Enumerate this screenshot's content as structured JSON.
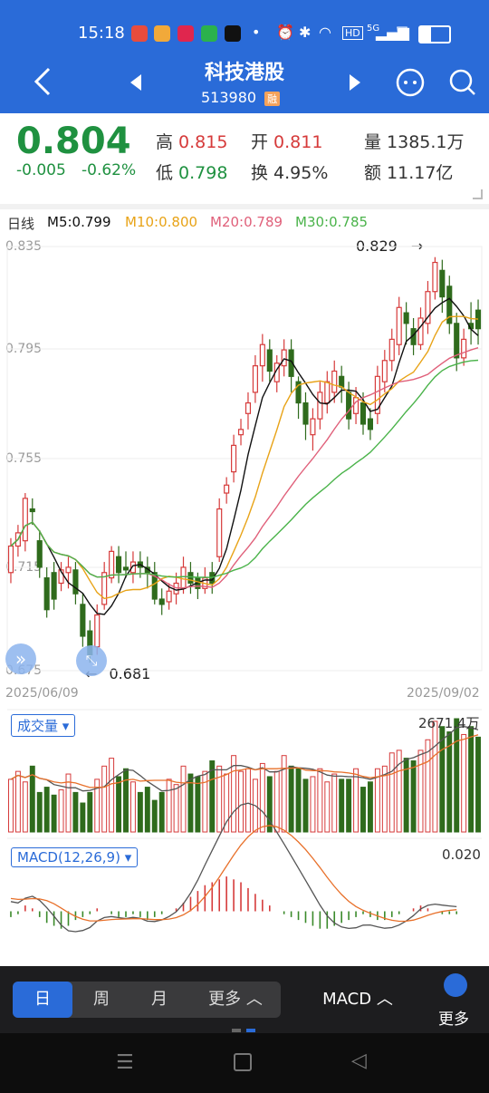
{
  "status": {
    "time": "15:18",
    "right_badges": [
      "HD",
      "5G"
    ]
  },
  "header": {
    "title": "科技港股",
    "code": "513980",
    "badge": "融"
  },
  "quote": {
    "price": "0.804",
    "change": "-0.005",
    "change_pct": "-0.62%",
    "high_label": "高",
    "high": "0.815",
    "open_label": "开",
    "open": "0.811",
    "volume_label": "量",
    "volume": "1385.1万",
    "low_label": "低",
    "low": "0.798",
    "turnover_label": "换",
    "turnover": "4.95%",
    "amount_label": "额",
    "amount": "11.17亿"
  },
  "ma_legend": {
    "period": "日线",
    "m5": "M5:0.799",
    "m10": "M10:0.800",
    "m20": "M20:0.789",
    "m30": "M30:0.785"
  },
  "chart_data": [
    {
      "type": "candlestick",
      "y_ticks": [
        "0.835",
        "0.795",
        "0.755",
        "0.715",
        "0.675"
      ],
      "ylim": [
        0.675,
        0.835
      ],
      "x_start": "2025/06/09",
      "x_end": "2025/09/02",
      "annotations": [
        {
          "text": "0.829",
          "arrow": "→"
        },
        {
          "text": "0.681",
          "arrow": "←"
        }
      ],
      "candles": [
        [
          0.712,
          0.722,
          0.708,
          0.725
        ],
        [
          0.722,
          0.727,
          0.718,
          0.73
        ],
        [
          0.724,
          0.74,
          0.72,
          0.742
        ],
        [
          0.736,
          0.735,
          0.73,
          0.74
        ],
        [
          0.724,
          0.714,
          0.71,
          0.728
        ],
        [
          0.71,
          0.698,
          0.695,
          0.714
        ],
        [
          0.712,
          0.702,
          0.698,
          0.716
        ],
        [
          0.708,
          0.713,
          0.705,
          0.716
        ],
        [
          0.712,
          0.714,
          0.706,
          0.718
        ],
        [
          0.713,
          0.704,
          0.7,
          0.716
        ],
        [
          0.7,
          0.688,
          0.684,
          0.704
        ],
        [
          0.69,
          0.681,
          0.678,
          0.694
        ],
        [
          0.684,
          0.696,
          0.681,
          0.7
        ],
        [
          0.7,
          0.712,
          0.698,
          0.716
        ],
        [
          0.71,
          0.72,
          0.708,
          0.722
        ],
        [
          0.718,
          0.712,
          0.708,
          0.722
        ],
        [
          0.714,
          0.713,
          0.71,
          0.72
        ],
        [
          0.712,
          0.716,
          0.708,
          0.72
        ],
        [
          0.716,
          0.714,
          0.71,
          0.72
        ],
        [
          0.714,
          0.712,
          0.706,
          0.718
        ],
        [
          0.712,
          0.702,
          0.7,
          0.716
        ],
        [
          0.702,
          0.7,
          0.696,
          0.706
        ],
        [
          0.701,
          0.705,
          0.698,
          0.708
        ],
        [
          0.704,
          0.708,
          0.7,
          0.712
        ],
        [
          0.706,
          0.714,
          0.704,
          0.718
        ],
        [
          0.712,
          0.708,
          0.704,
          0.716
        ],
        [
          0.71,
          0.706,
          0.702,
          0.712
        ],
        [
          0.706,
          0.71,
          0.704,
          0.714
        ],
        [
          0.712,
          0.708,
          0.704,
          0.716
        ],
        [
          0.718,
          0.736,
          0.716,
          0.74
        ],
        [
          0.742,
          0.745,
          0.738,
          0.748
        ],
        [
          0.75,
          0.76,
          0.746,
          0.764
        ],
        [
          0.764,
          0.766,
          0.76,
          0.77
        ],
        [
          0.772,
          0.776,
          0.766,
          0.78
        ],
        [
          0.78,
          0.79,
          0.776,
          0.794
        ],
        [
          0.79,
          0.798,
          0.784,
          0.802
        ],
        [
          0.796,
          0.788,
          0.784,
          0.8
        ],
        [
          0.784,
          0.791,
          0.78,
          0.794
        ],
        [
          0.79,
          0.796,
          0.786,
          0.8
        ],
        [
          0.796,
          0.786,
          0.78,
          0.8
        ],
        [
          0.784,
          0.776,
          0.77,
          0.786
        ],
        [
          0.776,
          0.768,
          0.762,
          0.78
        ],
        [
          0.764,
          0.77,
          0.758,
          0.774
        ],
        [
          0.77,
          0.78,
          0.766,
          0.784
        ],
        [
          0.776,
          0.784,
          0.772,
          0.788
        ],
        [
          0.78,
          0.788,
          0.776,
          0.792
        ],
        [
          0.786,
          0.782,
          0.776,
          0.79
        ],
        [
          0.78,
          0.77,
          0.766,
          0.784
        ],
        [
          0.772,
          0.778,
          0.768,
          0.782
        ],
        [
          0.776,
          0.768,
          0.764,
          0.78
        ],
        [
          0.77,
          0.766,
          0.762,
          0.774
        ],
        [
          0.772,
          0.786,
          0.768,
          0.79
        ],
        [
          0.784,
          0.792,
          0.78,
          0.796
        ],
        [
          0.792,
          0.8,
          0.788,
          0.804
        ],
        [
          0.798,
          0.812,
          0.794,
          0.816
        ],
        [
          0.81,
          0.806,
          0.798,
          0.814
        ],
        [
          0.804,
          0.798,
          0.794,
          0.808
        ],
        [
          0.798,
          0.808,
          0.796,
          0.812
        ],
        [
          0.806,
          0.818,
          0.802,
          0.822
        ],
        [
          0.818,
          0.829,
          0.815,
          0.831
        ],
        [
          0.826,
          0.816,
          0.81,
          0.83
        ],
        [
          0.82,
          0.806,
          0.802,
          0.824
        ],
        [
          0.806,
          0.793,
          0.788,
          0.81
        ],
        [
          0.793,
          0.8,
          0.79,
          0.804
        ],
        [
          0.806,
          0.804,
          0.798,
          0.814
        ],
        [
          0.811,
          0.804,
          0.798,
          0.815
        ]
      ]
    },
    {
      "type": "bar",
      "label": "成交量",
      "max_label": "2671.4万",
      "values": [
        40,
        46,
        38,
        50,
        30,
        34,
        28,
        32,
        44,
        30,
        22,
        30,
        40,
        50,
        56,
        42,
        48,
        38,
        30,
        34,
        24,
        30,
        40,
        36,
        50,
        44,
        42,
        46,
        54,
        50,
        44,
        58,
        46,
        48,
        40,
        52,
        42,
        46,
        58,
        50,
        48,
        40,
        42,
        48,
        38,
        44,
        40,
        40,
        48,
        34,
        38,
        48,
        50,
        60,
        62,
        56,
        54,
        62,
        70,
        84,
        80,
        76,
        86,
        74,
        80,
        72
      ]
    },
    {
      "type": "bar",
      "label": "MACD(12,26,9)",
      "max_label": "0.020",
      "values": [
        -2,
        -1,
        2,
        1,
        -2,
        -4,
        -5,
        -6,
        -5,
        -3,
        -2,
        -1,
        1,
        0,
        -1,
        -2,
        -2,
        -1,
        -2,
        -3,
        -2,
        -1,
        0,
        1,
        3,
        5,
        7,
        9,
        10,
        11,
        12,
        11,
        10,
        8,
        6,
        4,
        2,
        0,
        -1,
        -2,
        -3,
        -4,
        -5,
        -6,
        -6,
        -5,
        -4,
        -3,
        -2,
        -1,
        -2,
        -3,
        -3,
        -2,
        -1,
        0,
        1,
        2,
        1,
        0,
        -1,
        -1,
        -1
      ]
    }
  ],
  "volume_legend": {
    "label": "成交量",
    "max": "2671.4万"
  },
  "macd_legend": {
    "label": "MACD(12,26,9)",
    "max": "0.020"
  },
  "bottom_tabs": {
    "day": "日",
    "week": "周",
    "month": "月",
    "more": "更多",
    "indicator": "MACD",
    "more_menu": "更多"
  }
}
